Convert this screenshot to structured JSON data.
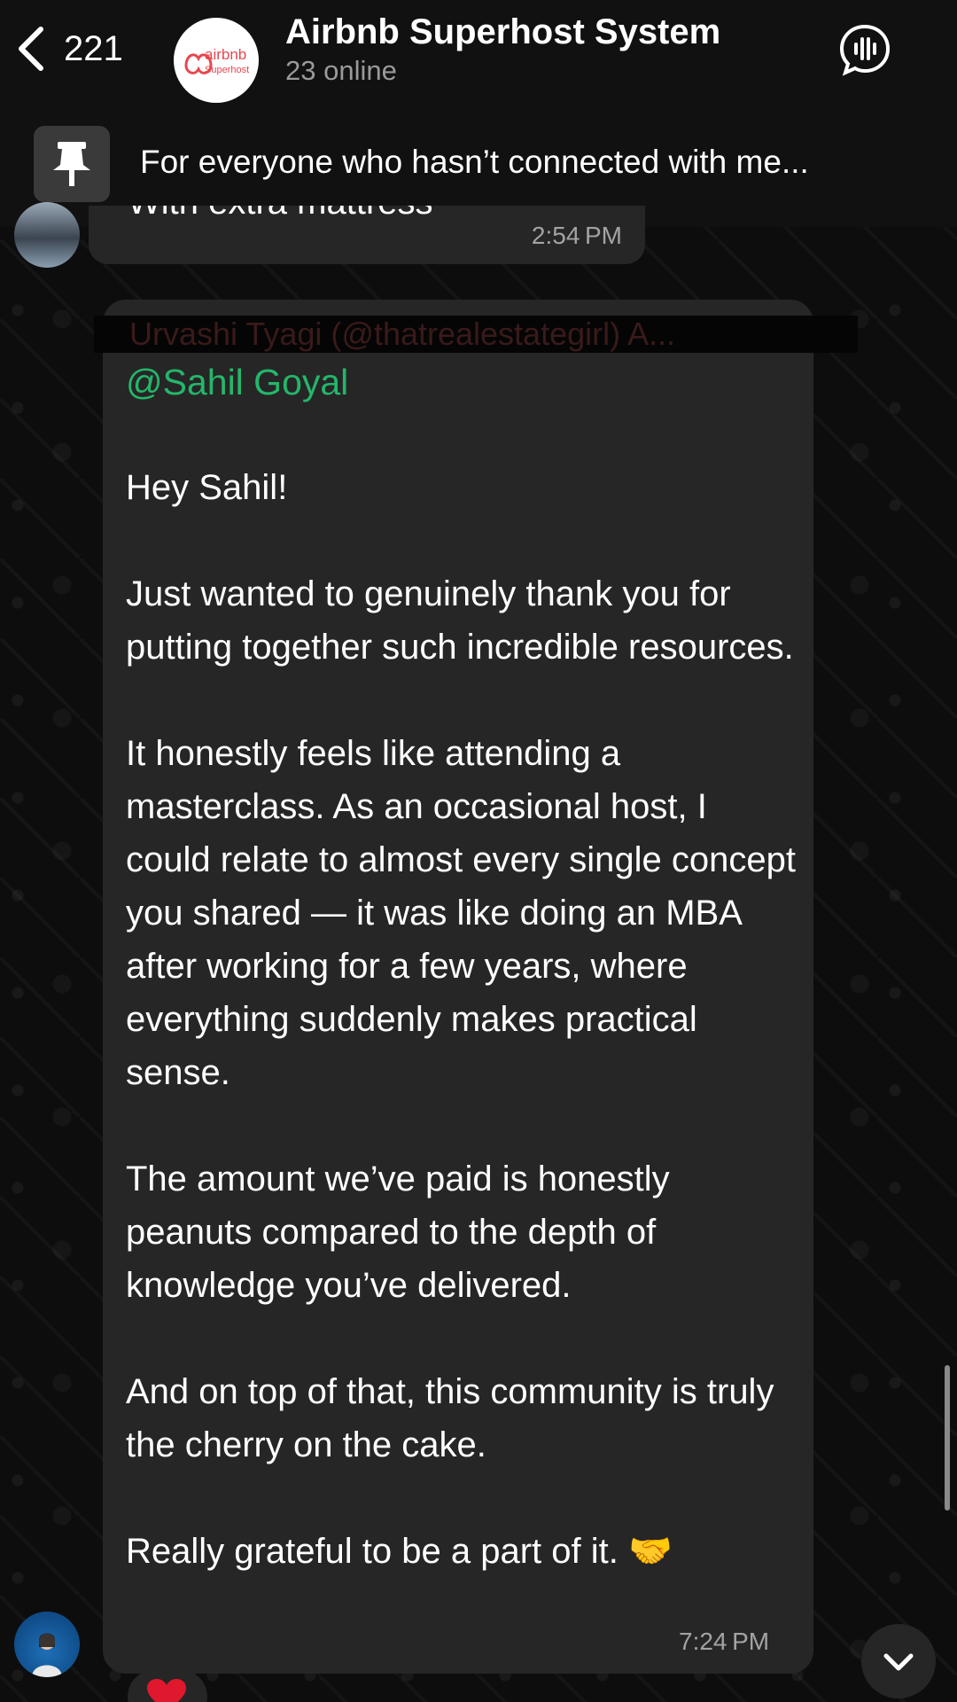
{
  "header": {
    "back_count": "221",
    "group_name": "Airbnb Superhost System",
    "online_status": "23 online",
    "avatar_logo_text": "airbnb",
    "avatar_logo_sub": "Superhost"
  },
  "pinned": {
    "text": "For everyone who hasn’t connected with me..."
  },
  "previous_message": {
    "partial_text": "With extra mattress",
    "time": "2:54 PM"
  },
  "message": {
    "quoted_sender": "Urvashi Tyagi (@thatrealestategirl) A...",
    "mention": "@Sahil Goyal",
    "body": "Hey Sahil!\n\nJust wanted to genuinely thank you for putting together such incredible resources.\n\nIt honestly feels like attending a masterclass. As an occasional host, I could relate to almost every single concept you shared — it was like doing an MBA after working for a few years, where everything suddenly makes practical sense.\n\nThe amount we’ve paid is honestly peanuts compared to the depth of knowledge you’ve delivered.\n\nAnd on top of that, this community is truly the cherry on the cake.\n\nReally grateful to be a part of it. 🤝",
    "time": "7:24 PM",
    "reaction_icon": "heart-icon"
  },
  "colors": {
    "mention": "#24b66a",
    "bubble": "#262626",
    "timestamp": "#a3a3a3",
    "reaction": "#e0182d"
  }
}
